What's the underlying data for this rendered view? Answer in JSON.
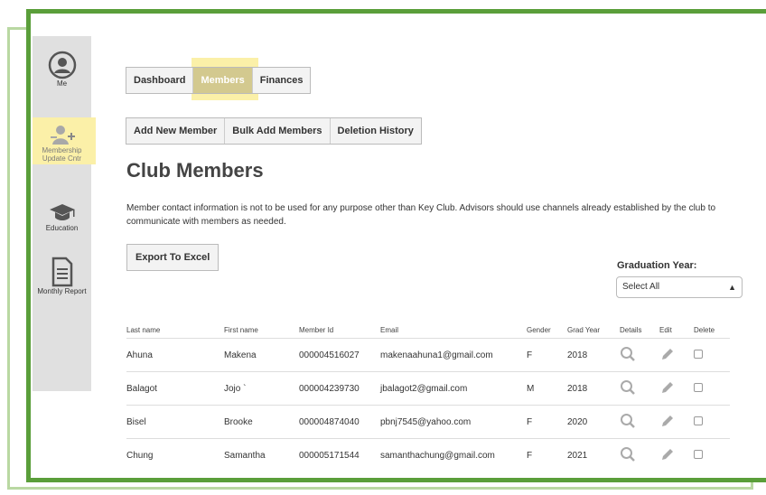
{
  "sidebar": {
    "items": [
      {
        "label": "Me",
        "icon": "user-circle-icon"
      },
      {
        "label": "Membership Update Cntr",
        "icon": "add-user-icon"
      },
      {
        "label": "Education",
        "icon": "graduation-cap-icon"
      },
      {
        "label": "Monthly Report",
        "icon": "document-icon"
      }
    ]
  },
  "tabs": [
    "Dashboard",
    "Members",
    "Finances"
  ],
  "sub_tabs": [
    "Add New Member",
    "Bulk Add Members",
    "Deletion History"
  ],
  "page_title": "Club Members",
  "description": "Member contact information is not to be used for any purpose other than Key Club. Advisors should use channels already established by the club to communicate with members as needed.",
  "export_label": "Export To Excel",
  "grad_year": {
    "label": "Graduation Year:",
    "selected": "Select All"
  },
  "table": {
    "headers": [
      "Last name",
      "First name",
      "Member Id",
      "Email",
      "Gender",
      "Grad Year",
      "Details",
      "Edit",
      "Delete"
    ],
    "rows": [
      {
        "last": "Ahuna",
        "first": "Makena",
        "id": "000004516027",
        "email": "makenaahuna1@gmail.com",
        "gender": "F",
        "year": "2018"
      },
      {
        "last": "Balagot",
        "first": "Jojo `",
        "id": "000004239730",
        "email": "jbalagot2@gmail.com",
        "gender": "M",
        "year": "2018"
      },
      {
        "last": "Bisel",
        "first": "Brooke",
        "id": "000004874040",
        "email": "pbnj7545@yahoo.com",
        "gender": "F",
        "year": "2020"
      },
      {
        "last": "Chung",
        "first": "Samantha",
        "id": "000005171544",
        "email": "samanthachung@gmail.com",
        "gender": "F",
        "year": "2021"
      }
    ]
  },
  "colors": {
    "frame": "#5a9e3a",
    "frame_light": "#b9d8a2",
    "highlight": "#fbf0a8",
    "sidebar": "#e0e0e0"
  }
}
